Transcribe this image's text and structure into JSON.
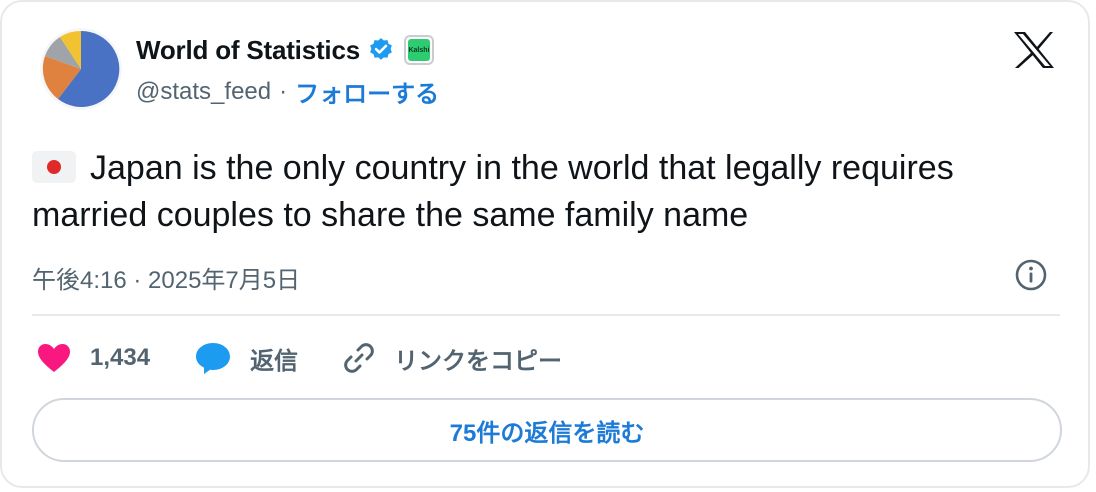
{
  "author": {
    "name": "World of Statistics",
    "handle": "@stats_feed",
    "separator": "·",
    "follow_label": "フォローする",
    "affiliate_badge_text": "Kalshi"
  },
  "tweet": {
    "flag": "japan-flag",
    "text": "Japan is the only country in the world that legally requires married couples to share the same family name",
    "timestamp": "午後4:16 · 2025年7月5日"
  },
  "actions": {
    "like_count": "1,434",
    "reply_label": "返信",
    "copy_link_label": "リンクをコピー"
  },
  "read_replies_label": "75件の返信を読む",
  "colors": {
    "accent": "#1d7bd8",
    "like": "#f91880",
    "reply": "#1d9bf0",
    "verified": "#1d9bf0"
  }
}
